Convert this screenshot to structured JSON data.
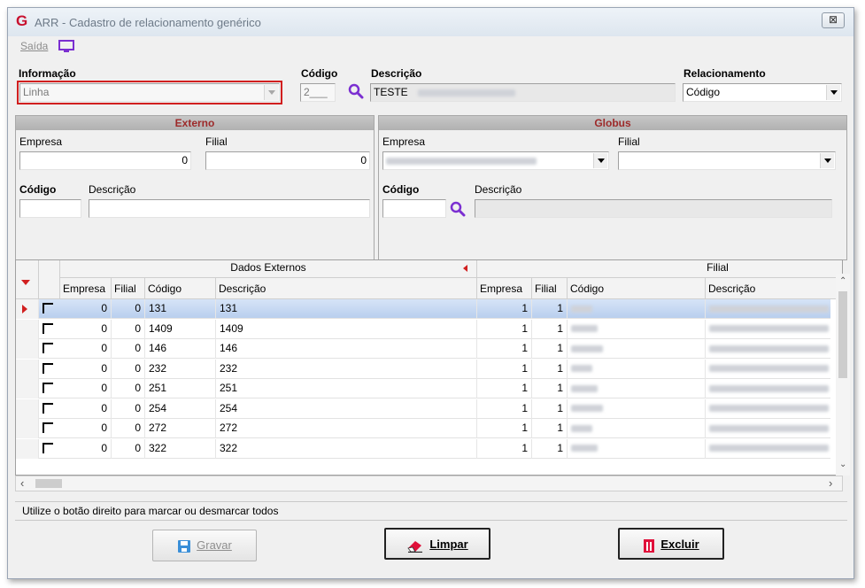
{
  "window": {
    "title": "ARR - Cadastro de relacionamento genérico",
    "close_label": "⊠"
  },
  "menu": {
    "saida_label": "Saída"
  },
  "top": {
    "informacao_label": "Informação",
    "informacao_value": "Linha",
    "codigo_label": "Código",
    "codigo_value": "2___",
    "descricao_label": "Descrição",
    "descricao_value": "TESTE",
    "relacionamento_label": "Relacionamento",
    "relacionamento_value": "Código"
  },
  "externo": {
    "title": "Externo",
    "empresa_label": "Empresa",
    "empresa_value": "0",
    "filial_label": "Filial",
    "filial_value": "0",
    "codigo_label": "Código",
    "descricao_label": "Descrição"
  },
  "globus": {
    "title": "Globus",
    "empresa_label": "Empresa",
    "filial_label": "Filial",
    "codigo_label": "Código",
    "descricao_label": "Descrição"
  },
  "grid": {
    "group_left": "Dados Externos",
    "group_right": "Filial",
    "columns_left": [
      "Empresa",
      "Filial",
      "Código",
      "Descrição"
    ],
    "columns_right": [
      "Empresa",
      "Filial",
      "Código",
      "Descrição"
    ],
    "rows": [
      {
        "empresa": "0",
        "filial": "0",
        "codigo": "131",
        "descricao": "131",
        "g_empresa": "1",
        "g_filial": "1"
      },
      {
        "empresa": "0",
        "filial": "0",
        "codigo": "1409",
        "descricao": "1409",
        "g_empresa": "1",
        "g_filial": "1"
      },
      {
        "empresa": "0",
        "filial": "0",
        "codigo": "146",
        "descricao": "146",
        "g_empresa": "1",
        "g_filial": "1"
      },
      {
        "empresa": "0",
        "filial": "0",
        "codigo": "232",
        "descricao": "232",
        "g_empresa": "1",
        "g_filial": "1"
      },
      {
        "empresa": "0",
        "filial": "0",
        "codigo": "251",
        "descricao": "251",
        "g_empresa": "1",
        "g_filial": "1"
      },
      {
        "empresa": "0",
        "filial": "0",
        "codigo": "254",
        "descricao": "254",
        "g_empresa": "1",
        "g_filial": "1"
      },
      {
        "empresa": "0",
        "filial": "0",
        "codigo": "272",
        "descricao": "272",
        "g_empresa": "1",
        "g_filial": "1"
      },
      {
        "empresa": "0",
        "filial": "0",
        "codigo": "322",
        "descricao": "322",
        "g_empresa": "1",
        "g_filial": "1"
      }
    ]
  },
  "status": {
    "text": "Utilize o botão direito para marcar ou desmarcar todos"
  },
  "buttons": {
    "gravar": "Gravar",
    "limpar": "Limpar",
    "excluir": "Excluir"
  },
  "colors": {
    "highlight_border": "#d11f1f",
    "accent_purple": "#7b2fd1",
    "panel_title": "#9d2a2a"
  }
}
